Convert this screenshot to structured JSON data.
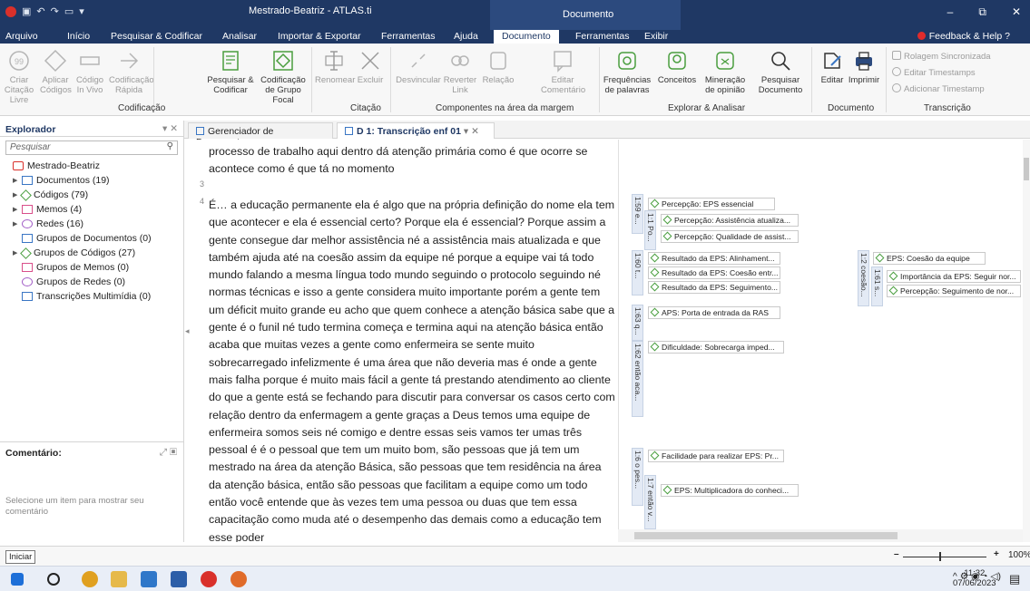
{
  "titlebar": {
    "title": "Mestrado-Beatriz - ATLAS.ti",
    "context_title": "Documento",
    "minimize": "–",
    "restore": "⧉",
    "close": "✕"
  },
  "menu": {
    "tabs": [
      "Arquivo",
      "Início",
      "Pesquisar & Codificar",
      "Analisar",
      "Importar & Exportar",
      "Ferramentas",
      "Ajuda",
      "Documento",
      "Ferramentas",
      "Exibir"
    ],
    "active_tab": "Documento",
    "feedback": "Feedback & Help",
    "help": "?"
  },
  "ribbon": {
    "buttons": {
      "criar_citacao": "Criar Citação Livre",
      "aplicar_codigos": "Aplicar Códigos",
      "codigo_in_vivo": "Código In Vivo",
      "codificacao_rapida": "Codificação Rápida",
      "pesquisar_codificar": "Pesquisar & Codificar",
      "codificacao_grupo_focal": "Codificação de Grupo Focal",
      "renomear": "Renomear",
      "excluir": "Excluir",
      "desvincular": "Desvincular",
      "reverter_link": "Reverter Link",
      "relacao": "Relação",
      "editar_comentario": "Editar Comentário",
      "frequencias": "Frequências de palavras",
      "conceitos": "Conceitos",
      "mineracao": "Mineração de opinião",
      "pesquisar_documento": "Pesquisar Documento",
      "editar": "Editar",
      "imprimir": "Imprimir",
      "rolagem": "Rolagem Sincronizada",
      "editar_timestamps": "Editar Timestamps",
      "adicionar_timestamp": "Adicionar Timestamp"
    },
    "groups": {
      "codificacao": "Codificação",
      "citacao": "Citação",
      "componentes": "Componentes na área da margem",
      "explorar": "Explorar & Analisar",
      "documento": "Documento",
      "transcricao": "Transcrição"
    }
  },
  "explorer": {
    "title": "Explorador",
    "search_placeholder": "Pesquisar",
    "project": "Mestrado-Beatriz",
    "items": [
      {
        "label": "Documentos (19)",
        "color": "#3a76c4"
      },
      {
        "label": "Códigos (79)",
        "color": "#4a9e3f"
      },
      {
        "label": "Memos (4)",
        "color": "#d94f8a"
      },
      {
        "label": "Redes (16)",
        "color": "#a35fc7"
      },
      {
        "label": "Grupos de Documentos (0)",
        "color": "#3a76c4"
      },
      {
        "label": "Grupos de Códigos (27)",
        "color": "#4a9e3f"
      },
      {
        "label": "Grupos de Memos (0)",
        "color": "#d94f8a"
      },
      {
        "label": "Grupos de Redes (0)",
        "color": "#a35fc7"
      },
      {
        "label": "Transcrições Multimídia (0)",
        "color": "#3a76c4"
      }
    ],
    "comment_title": "Comentário:",
    "comment_hint": "Selecione um item para mostrar seu comentário"
  },
  "doc_tabs": {
    "manager": "Gerenciador de Documentos",
    "active": "D 1: Transcrição enf 01"
  },
  "document": {
    "para_top": "processo de trabalho aqui dentro dá atenção primária como é que ocorre se acontece como é que tá no momento",
    "line3": "3",
    "line4": "4",
    "para_main": "É… a educação permanente ela é algo que na própria definição do nome ela tem que acontecer e ela é essencial certo? Porque ela é essencial? Porque assim a gente consegue dar melhor assistência né a assistência mais atualizada e que também ajuda até na coesão assim da equipe né porque a equipe vai tá todo mundo falando a mesma língua todo mundo seguindo o protocolo seguindo né normas técnicas e isso a gente considera muito importante porém a gente tem um déficit muito grande eu acho que quem conhece a atenção básica sabe que a gente é o funil né tudo termina começa e termina aqui na atenção básica então acaba que muitas vezes a gente como enfermeira se sente muito sobrecarregado infelizmente é uma área que não deveria mas é onde a gente mais falha porque é muito mais fácil a gente tá prestando atendimento ao cliente do que a gente está se fechando para discutir para conversar os casos certo com relação dentro da enfermagem a gente graças a Deus temos uma equipe de enfermeira somos seis né comigo e dentre essas seis vamos ter umas três pessoal é é o pessoal que tem um muito bom, são pessoas que já tem um mestrado na área da atenção Básica, são pessoas que tem residência na área da atenção básica, então são pessoas que facilitam a equipe como um todo então você entende que às vezes tem uma pessoa ou duas que tem essa capacitação como muda até o desempenho das demais como a educação tem esse poder"
  },
  "margin": {
    "quotations": [
      {
        "label": "1:59 e..."
      },
      {
        "label": "1:1 Po..."
      },
      {
        "label": "1:60 t..."
      },
      {
        "label": "1:63 q..."
      },
      {
        "label": "1:62 então aca..."
      },
      {
        "label": "1:6 o pes..."
      },
      {
        "label": "1:7 então v..."
      },
      {
        "label": "1:2 coesão..."
      },
      {
        "label": "1:61 s..."
      }
    ],
    "codes": [
      {
        "label": "Percepção: EPS essencial"
      },
      {
        "label": "Percepção: Assistência atualiza..."
      },
      {
        "label": "Percepção: Qualidade de assist..."
      },
      {
        "label": "Resultado da EPS: Alinhament..."
      },
      {
        "label": "Resultado da EPS: Coesão entr..."
      },
      {
        "label": "Resultado da EPS: Seguimento..."
      },
      {
        "label": "APS: Porta de entrada da RAS"
      },
      {
        "label": "Dificuldade: Sobrecarga imped..."
      },
      {
        "label": "Facilidade para realizar EPS: Pr..."
      },
      {
        "label": "EPS: Multiplicadora do conheci..."
      },
      {
        "label": "EPS: Coesão da equipe"
      },
      {
        "label": "Importância da EPS: Seguir nor..."
      },
      {
        "label": "Percepção: Seguimento de nor..."
      }
    ]
  },
  "statusbar": {
    "start_tooltip": "Iniciar",
    "zoom_minus": "–",
    "zoom_plus": "+",
    "zoom": "100%"
  },
  "taskbar": {
    "time": "11:32",
    "date": "07/06/2023"
  }
}
